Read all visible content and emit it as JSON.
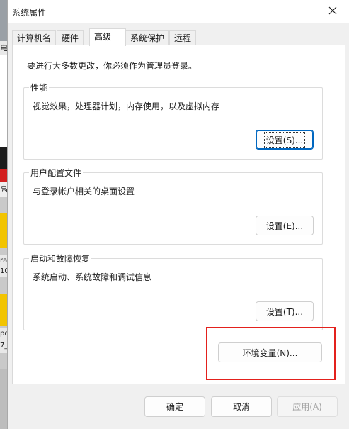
{
  "window": {
    "title": "系统属性"
  },
  "tabs": [
    "计算机名",
    "硬件",
    "高级",
    "系统保护",
    "远程"
  ],
  "notice": "要进行大多数更改，你必须作为管理员登录。",
  "performance": {
    "legend": "性能",
    "desc": "视觉效果，处理器计划，内存使用，以及虚拟内存",
    "button": "设置(S)..."
  },
  "user_profiles": {
    "legend": "用户配置文件",
    "desc": "与登录帐户相关的桌面设置",
    "button": "设置(E)..."
  },
  "startup_recovery": {
    "legend": "启动和故障恢复",
    "desc": "系统启动、系统故障和调试信息",
    "button": "设置(T)..."
  },
  "env_vars_button": "环境变量(N)...",
  "footer": {
    "ok": "确定",
    "cancel": "取消",
    "apply": "应用(A)"
  },
  "desktop_fragments": [
    "电",
    "高",
    "ra",
    "10",
    "ро",
    "7_"
  ]
}
